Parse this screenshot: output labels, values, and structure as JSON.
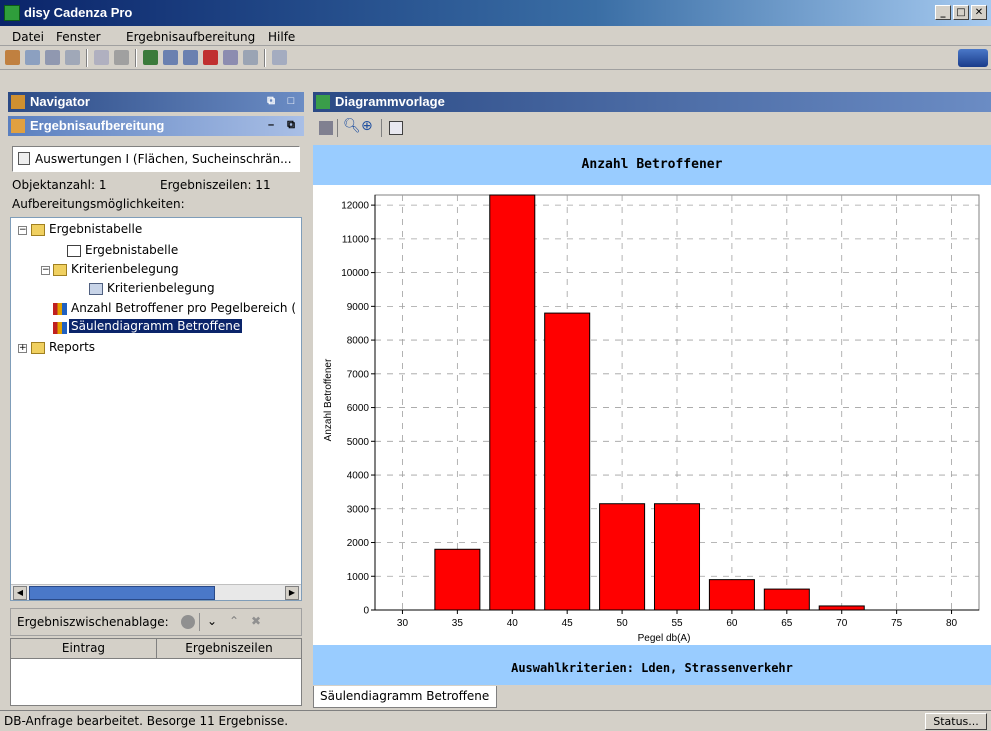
{
  "window": {
    "title": "disy Cadenza Pro"
  },
  "menu": [
    "Datei",
    "Fenster",
    "Ergebnisaufbereitung",
    "Hilfe"
  ],
  "navigator": {
    "title": "Navigator"
  },
  "ergebnis": {
    "title": "Ergebnisaufbereitung",
    "selector": "Auswertungen I (Flächen, Sucheinschrän...",
    "objektanzahl": "Objektanzahl: 1",
    "ergebniszeilen": "Ergebniszeilen: 11",
    "aufbereitung_label": "Aufbereitungsmöglichkeiten:",
    "tree": [
      "Ergebnistabelle",
      "Ergebnistabelle",
      "Kriterienbelegung",
      "Kriterienbelegung",
      "Anzahl Betroffener pro Pegelbereich (",
      "Säulendiagramm Betroffene",
      "Reports"
    ],
    "zwischenablage_label": "Ergebniszwischenablage:",
    "table_headers": [
      "Eintrag",
      "Ergebniszeilen"
    ]
  },
  "diagram": {
    "title": "Diagrammvorlage",
    "tab_label": "Säulendiagramm Betroffene"
  },
  "status": {
    "message": "DB-Anfrage bearbeitet. Besorge 11 Ergebnisse.",
    "button": "Status..."
  },
  "chart_data": {
    "type": "bar",
    "title": "Anzahl Betroffener",
    "footer": "Auswahlkriterien: Lden, Strassenverkehr",
    "xlabel": "Pegel db(A)",
    "ylabel": "Anzahl Betroffener",
    "x_ticks": [
      "30",
      "35",
      "40",
      "45",
      "50",
      "55",
      "60",
      "65",
      "70",
      "75",
      "80"
    ],
    "y_ticks": [
      "0",
      "1000",
      "2000",
      "3000",
      "4000",
      "5000",
      "6000",
      "7000",
      "8000",
      "9000",
      "10000",
      "11000",
      "12000"
    ],
    "categories": [
      35,
      40,
      45,
      50,
      55,
      60,
      65,
      70
    ],
    "values": [
      1800,
      12300,
      8800,
      3150,
      3150,
      900,
      620,
      120
    ],
    "ylim": [
      0,
      12300
    ],
    "xlim": [
      27.5,
      82.5
    ],
    "bar_color": "#ff0000",
    "grid": true
  }
}
